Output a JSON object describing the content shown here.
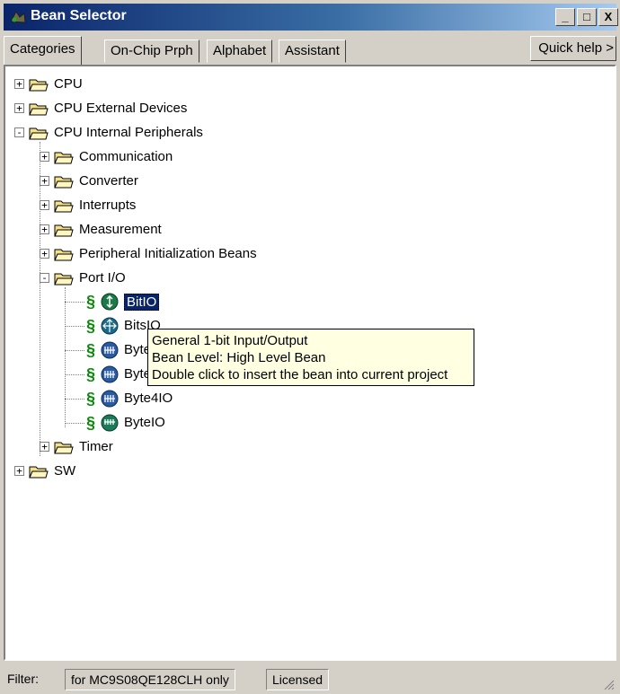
{
  "window": {
    "title": "Bean Selector",
    "minimize": "_",
    "maximize": "□",
    "close": "X"
  },
  "tabs": {
    "items": [
      "Categories",
      "On-Chip Prph",
      "Alphabet",
      "Assistant"
    ],
    "active": "Categories",
    "quick_help": "Quick help >"
  },
  "tree": {
    "top": [
      {
        "label": "CPU",
        "state": "+"
      },
      {
        "label": "CPU External Devices",
        "state": "+"
      },
      {
        "label": "CPU Internal Peripherals",
        "state": "-"
      }
    ],
    "internal_children": [
      {
        "label": "Communication",
        "state": "+"
      },
      {
        "label": "Converter",
        "state": "+"
      },
      {
        "label": "Interrupts",
        "state": "+"
      },
      {
        "label": "Measurement",
        "state": "+"
      },
      {
        "label": "Peripheral Initialization Beans",
        "state": "+"
      },
      {
        "label": "Port I/O",
        "state": "-"
      }
    ],
    "beans": [
      {
        "label": "BitIO",
        "icon": "bit-bean-icon",
        "selected": true
      },
      {
        "label": "BitsIO",
        "icon": "bits-bean-icon"
      },
      {
        "label": "Byte2IO",
        "icon": "byte-bean-icon"
      },
      {
        "label": "Byte3IO",
        "icon": "byte-bean-icon"
      },
      {
        "label": "Byte4IO",
        "icon": "byte-bean-icon"
      },
      {
        "label": "ByteIO",
        "icon": "byte-bean-icon"
      }
    ],
    "after": [
      {
        "label": "Timer",
        "state": "+"
      },
      {
        "label": "SW",
        "state": "+"
      }
    ]
  },
  "tooltip": {
    "line1": "General 1-bit Input/Output",
    "line2": "Bean Level: High Level Bean",
    "line3": "Double click to insert the bean into current project"
  },
  "status": {
    "filter_label": "Filter:",
    "filter_value": "for MC9S08QE128CLH only",
    "license": "Licensed"
  },
  "colors": {
    "title_gradient_start": "#0a246a",
    "title_gradient_end": "#a6caf0",
    "tooltip_bg": "#ffffe1",
    "bean_s_color": "#0a8a0a",
    "folder_color": "#f5e08a"
  }
}
